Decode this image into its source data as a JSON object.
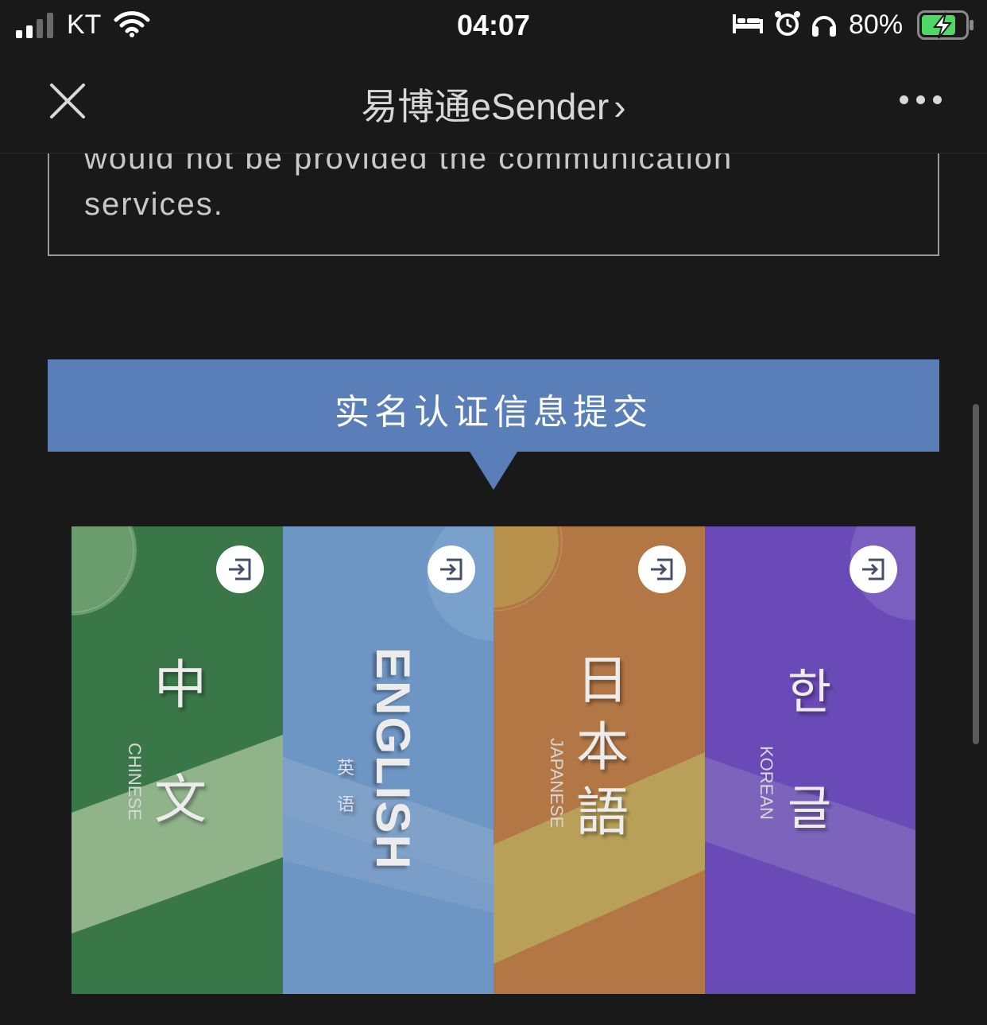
{
  "status_bar": {
    "carrier": "KT",
    "time": "04:07",
    "battery_percent": "80%",
    "signal_bars": 2,
    "icons": [
      "signal-icon",
      "wifi-icon",
      "bed-icon",
      "alarm-icon",
      "headphones-icon",
      "battery-charging-icon"
    ]
  },
  "nav": {
    "title": "易博通eSender",
    "title_chevron": "›",
    "close_icon": "close-icon",
    "more_icon": "more-icon"
  },
  "notice": {
    "text_partial": "would not be provided the communication",
    "text_end": "services."
  },
  "banner": {
    "label": "实名认证信息提交"
  },
  "languages": [
    {
      "name": "中文",
      "glyph_1": "中",
      "glyph_2": "文",
      "english": "CHINESE",
      "color": "#3a7748",
      "stripe": "#90b38a"
    },
    {
      "name": "ENGLISH",
      "vertical": "ENGLISH",
      "sub": "英语",
      "sub_1": "英",
      "sub_2": "语",
      "color": "#6e96c4",
      "stripe": "#81a2c8"
    },
    {
      "name": "日本語",
      "glyph_1": "日",
      "glyph_2": "本",
      "glyph_3": "語",
      "english": "JAPANESE",
      "color": "#b27745",
      "stripe": "#b9a058"
    },
    {
      "name": "한글",
      "glyph_1": "한",
      "glyph_2": "글",
      "english": "KOREAN",
      "color": "#6a4ab6",
      "stripe": "#7c64bc"
    }
  ],
  "colors": {
    "background": "#191919",
    "banner": "#5a7fb8",
    "battery_fill": "#4cd964"
  }
}
